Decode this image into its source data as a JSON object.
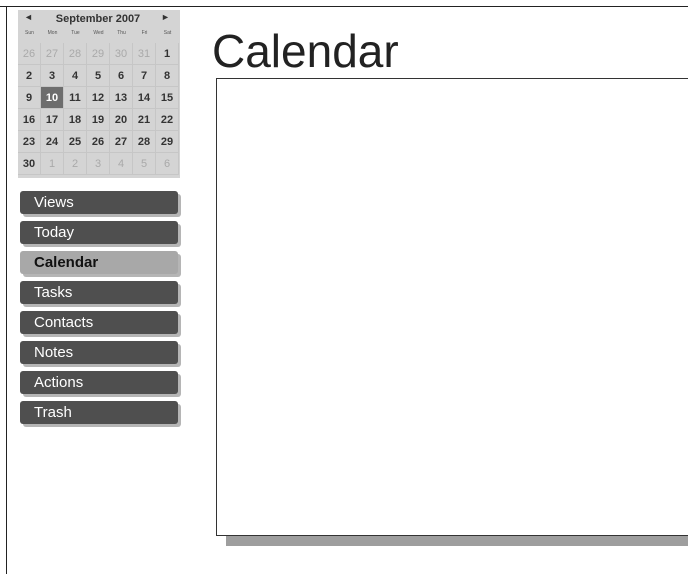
{
  "mini_calendar": {
    "prev": "◄",
    "next": "►",
    "month_year": "September 2007",
    "weekdays": [
      "Sun",
      "Mon",
      "Tue",
      "Wed",
      "Thu",
      "Fri",
      "Sat"
    ],
    "days": [
      {
        "d": "26",
        "other": true
      },
      {
        "d": "27",
        "other": true
      },
      {
        "d": "28",
        "other": true
      },
      {
        "d": "29",
        "other": true
      },
      {
        "d": "30",
        "other": true
      },
      {
        "d": "31",
        "other": true
      },
      {
        "d": "1"
      },
      {
        "d": "2"
      },
      {
        "d": "3"
      },
      {
        "d": "4"
      },
      {
        "d": "5"
      },
      {
        "d": "6"
      },
      {
        "d": "7"
      },
      {
        "d": "8"
      },
      {
        "d": "9"
      },
      {
        "d": "10",
        "selected": true
      },
      {
        "d": "11"
      },
      {
        "d": "12"
      },
      {
        "d": "13"
      },
      {
        "d": "14"
      },
      {
        "d": "15"
      },
      {
        "d": "16"
      },
      {
        "d": "17"
      },
      {
        "d": "18"
      },
      {
        "d": "19"
      },
      {
        "d": "20"
      },
      {
        "d": "21"
      },
      {
        "d": "22"
      },
      {
        "d": "23"
      },
      {
        "d": "24"
      },
      {
        "d": "25"
      },
      {
        "d": "26"
      },
      {
        "d": "27"
      },
      {
        "d": "28"
      },
      {
        "d": "29"
      },
      {
        "d": "30"
      },
      {
        "d": "1",
        "other": true
      },
      {
        "d": "2",
        "other": true
      },
      {
        "d": "3",
        "other": true
      },
      {
        "d": "4",
        "other": true
      },
      {
        "d": "5",
        "other": true
      },
      {
        "d": "6",
        "other": true
      }
    ]
  },
  "nav": {
    "items": [
      {
        "label": "Views",
        "name": "nav-views"
      },
      {
        "label": "Today",
        "name": "nav-today"
      },
      {
        "label": "Calendar",
        "name": "nav-calendar",
        "active": true
      },
      {
        "label": "Tasks",
        "name": "nav-tasks"
      },
      {
        "label": "Contacts",
        "name": "nav-contacts"
      },
      {
        "label": "Notes",
        "name": "nav-notes"
      },
      {
        "label": "Actions",
        "name": "nav-actions"
      },
      {
        "label": "Trash",
        "name": "nav-trash"
      }
    ]
  },
  "main": {
    "title": "Calendar"
  },
  "colors": {
    "nav_bg": "#4f4f4f",
    "nav_active_bg": "#a8a8a8",
    "calendar_bg": "#d4d4d4",
    "selected_day": "#6d6d6d"
  }
}
